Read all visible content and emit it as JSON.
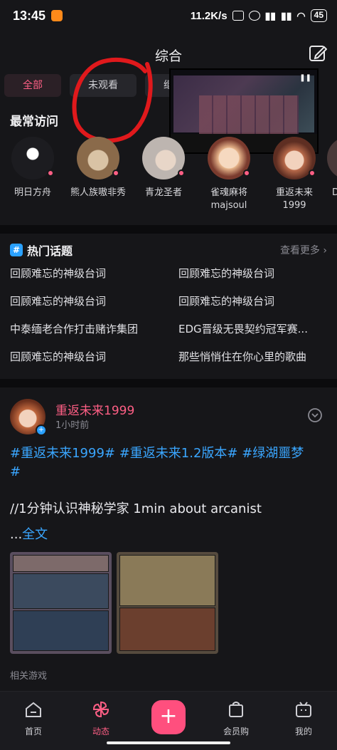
{
  "status_bar": {
    "time": "13:45",
    "network_speed": "11.2K/s",
    "battery": "45"
  },
  "header": {
    "title": "综合"
  },
  "tabs": [
    {
      "label": "全部",
      "active": true
    },
    {
      "label": "未观看",
      "active": false
    },
    {
      "label": "继续",
      "active": false
    }
  ],
  "frequent": {
    "title": "最常访问",
    "items": [
      {
        "name": "明日方舟",
        "name2": "",
        "avatar_color": "#1c1c20"
      },
      {
        "name": "熊人族嗷非秀",
        "name2": "",
        "avatar_color": "#8a6a4a"
      },
      {
        "name": "青龙圣者",
        "name2": "",
        "avatar_color": "#bdb5b0"
      },
      {
        "name": "雀魂麻将",
        "name2": "majsoul",
        "avatar_color": "#e6b48a"
      },
      {
        "name": "重返未来",
        "name2": "1999",
        "avatar_color": "#b86a4a"
      },
      {
        "name": "D",
        "name2": "",
        "avatar_color": "#4a3a3a"
      }
    ]
  },
  "hot_topics": {
    "title": "热门话题",
    "see_more": "查看更多",
    "items": [
      "回顾难忘的神级台词",
      "回顾难忘的神级台词",
      "回顾难忘的神级台词",
      "回顾难忘的神级台词",
      "中泰缅老合作打击赌诈集团",
      "EDG晋级无畏契约冠军赛...",
      "回顾难忘的神级台词",
      "那些悄悄住在你心里的歌曲"
    ]
  },
  "post": {
    "author": "重返未来1999",
    "time": "1小时前",
    "tags_line1": "#重返未来1999# #重返未来1.2版本# #绿湖噩梦",
    "tags_line2": "#",
    "body": "//1分钟认识神秘学家  1min about arcanist",
    "more_prefix": "...",
    "more_link": "全文"
  },
  "related_games": "相关游戏",
  "bottom_nav": {
    "home": "首页",
    "dynamic": "动态",
    "plus": "+",
    "shop": "会员购",
    "mine": "我的"
  },
  "colors": {
    "accent": "#ff5f85",
    "link": "#3aa6ff",
    "background": "#161619"
  }
}
